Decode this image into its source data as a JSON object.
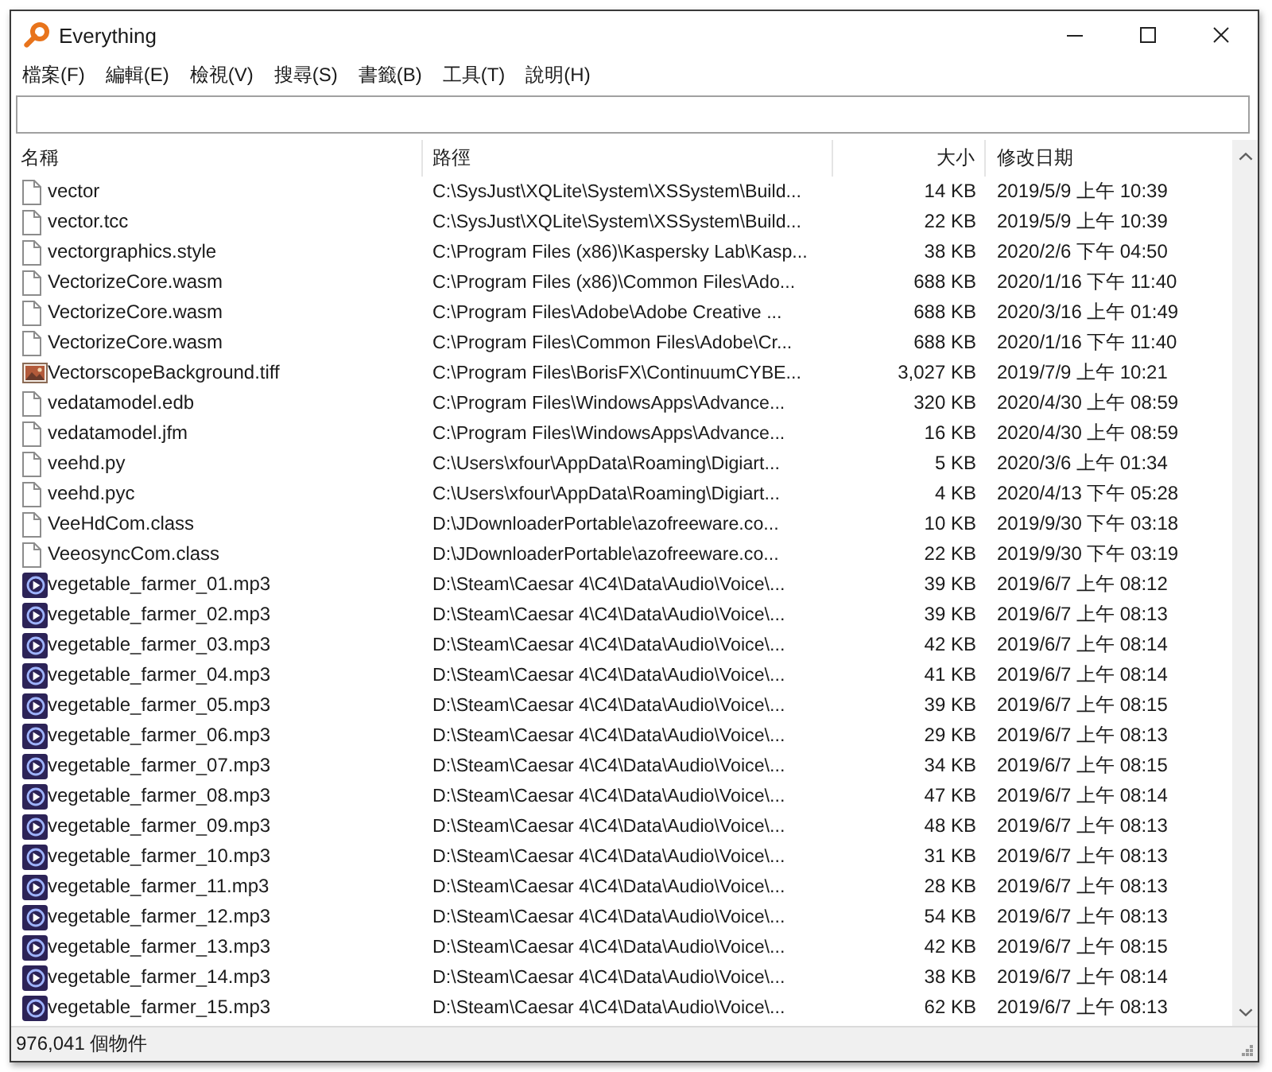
{
  "window": {
    "title": "Everything"
  },
  "menu": [
    "檔案(F)",
    "編輯(E)",
    "檢視(V)",
    "搜尋(S)",
    "書籤(B)",
    "工具(T)",
    "說明(H)"
  ],
  "table": {
    "columns": [
      "名稱",
      "路徑",
      "大小",
      "修改日期"
    ],
    "rows": [
      {
        "kind": "file",
        "name": "vector",
        "path": "C:\\SysJust\\XQLite\\System\\XSSystem\\Build...",
        "size": "14 KB",
        "modified": "2019/5/9 上午 10:39"
      },
      {
        "kind": "file",
        "name": "vector.tcc",
        "path": "C:\\SysJust\\XQLite\\System\\XSSystem\\Build...",
        "size": "22 KB",
        "modified": "2019/5/9 上午 10:39"
      },
      {
        "kind": "file",
        "name": "vectorgraphics.style",
        "path": "C:\\Program Files (x86)\\Kaspersky Lab\\Kasp...",
        "size": "38 KB",
        "modified": "2020/2/6 下午 04:50"
      },
      {
        "kind": "file",
        "name": "VectorizeCore.wasm",
        "path": "C:\\Program Files (x86)\\Common Files\\Ado...",
        "size": "688 KB",
        "modified": "2020/1/16 下午 11:40"
      },
      {
        "kind": "file",
        "name": "VectorizeCore.wasm",
        "path": "C:\\Program Files\\Adobe\\Adobe Creative ...",
        "size": "688 KB",
        "modified": "2020/3/16 上午 01:49"
      },
      {
        "kind": "file",
        "name": "VectorizeCore.wasm",
        "path": "C:\\Program Files\\Common Files\\Adobe\\Cr...",
        "size": "688 KB",
        "modified": "2020/1/16 下午 11:40"
      },
      {
        "kind": "image",
        "name": "VectorscopeBackground.tiff",
        "path": "C:\\Program Files\\BorisFX\\ContinuumCYBE...",
        "size": "3,027 KB",
        "modified": "2019/7/9 上午 10:21"
      },
      {
        "kind": "file",
        "name": "vedatamodel.edb",
        "path": "C:\\Program Files\\WindowsApps\\Advance...",
        "size": "320 KB",
        "modified": "2020/4/30 上午 08:59"
      },
      {
        "kind": "file",
        "name": "vedatamodel.jfm",
        "path": "C:\\Program Files\\WindowsApps\\Advance...",
        "size": "16 KB",
        "modified": "2020/4/30 上午 08:59"
      },
      {
        "kind": "file",
        "name": "veehd.py",
        "path": "C:\\Users\\xfour\\AppData\\Roaming\\Digiart...",
        "size": "5 KB",
        "modified": "2020/3/6 上午 01:34"
      },
      {
        "kind": "file",
        "name": "veehd.pyc",
        "path": "C:\\Users\\xfour\\AppData\\Roaming\\Digiart...",
        "size": "4 KB",
        "modified": "2020/4/13 下午 05:28"
      },
      {
        "kind": "file",
        "name": "VeeHdCom.class",
        "path": "D:\\JDownloaderPortable\\azofreeware.co...",
        "size": "10 KB",
        "modified": "2019/9/30 下午 03:18"
      },
      {
        "kind": "file",
        "name": "VeeosyncCom.class",
        "path": "D:\\JDownloaderPortable\\azofreeware.co...",
        "size": "22 KB",
        "modified": "2019/9/30 下午 03:19"
      },
      {
        "kind": "audio",
        "name": "vegetable_farmer_01.mp3",
        "path": "D:\\Steam\\Caesar 4\\C4\\Data\\Audio\\Voice\\...",
        "size": "39 KB",
        "modified": "2019/6/7 上午 08:12"
      },
      {
        "kind": "audio",
        "name": "vegetable_farmer_02.mp3",
        "path": "D:\\Steam\\Caesar 4\\C4\\Data\\Audio\\Voice\\...",
        "size": "39 KB",
        "modified": "2019/6/7 上午 08:13"
      },
      {
        "kind": "audio",
        "name": "vegetable_farmer_03.mp3",
        "path": "D:\\Steam\\Caesar 4\\C4\\Data\\Audio\\Voice\\...",
        "size": "42 KB",
        "modified": "2019/6/7 上午 08:14"
      },
      {
        "kind": "audio",
        "name": "vegetable_farmer_04.mp3",
        "path": "D:\\Steam\\Caesar 4\\C4\\Data\\Audio\\Voice\\...",
        "size": "41 KB",
        "modified": "2019/6/7 上午 08:14"
      },
      {
        "kind": "audio",
        "name": "vegetable_farmer_05.mp3",
        "path": "D:\\Steam\\Caesar 4\\C4\\Data\\Audio\\Voice\\...",
        "size": "39 KB",
        "modified": "2019/6/7 上午 08:15"
      },
      {
        "kind": "audio",
        "name": "vegetable_farmer_06.mp3",
        "path": "D:\\Steam\\Caesar 4\\C4\\Data\\Audio\\Voice\\...",
        "size": "29 KB",
        "modified": "2019/6/7 上午 08:13"
      },
      {
        "kind": "audio",
        "name": "vegetable_farmer_07.mp3",
        "path": "D:\\Steam\\Caesar 4\\C4\\Data\\Audio\\Voice\\...",
        "size": "34 KB",
        "modified": "2019/6/7 上午 08:15"
      },
      {
        "kind": "audio",
        "name": "vegetable_farmer_08.mp3",
        "path": "D:\\Steam\\Caesar 4\\C4\\Data\\Audio\\Voice\\...",
        "size": "47 KB",
        "modified": "2019/6/7 上午 08:14"
      },
      {
        "kind": "audio",
        "name": "vegetable_farmer_09.mp3",
        "path": "D:\\Steam\\Caesar 4\\C4\\Data\\Audio\\Voice\\...",
        "size": "48 KB",
        "modified": "2019/6/7 上午 08:13"
      },
      {
        "kind": "audio",
        "name": "vegetable_farmer_10.mp3",
        "path": "D:\\Steam\\Caesar 4\\C4\\Data\\Audio\\Voice\\...",
        "size": "31 KB",
        "modified": "2019/6/7 上午 08:13"
      },
      {
        "kind": "audio",
        "name": "vegetable_farmer_11.mp3",
        "path": "D:\\Steam\\Caesar 4\\C4\\Data\\Audio\\Voice\\...",
        "size": "28 KB",
        "modified": "2019/6/7 上午 08:13"
      },
      {
        "kind": "audio",
        "name": "vegetable_farmer_12.mp3",
        "path": "D:\\Steam\\Caesar 4\\C4\\Data\\Audio\\Voice\\...",
        "size": "54 KB",
        "modified": "2019/6/7 上午 08:13"
      },
      {
        "kind": "audio",
        "name": "vegetable_farmer_13.mp3",
        "path": "D:\\Steam\\Caesar 4\\C4\\Data\\Audio\\Voice\\...",
        "size": "42 KB",
        "modified": "2019/6/7 上午 08:15"
      },
      {
        "kind": "audio",
        "name": "vegetable_farmer_14.mp3",
        "path": "D:\\Steam\\Caesar 4\\C4\\Data\\Audio\\Voice\\...",
        "size": "38 KB",
        "modified": "2019/6/7 上午 08:14"
      },
      {
        "kind": "audio",
        "name": "vegetable_farmer_15.mp3",
        "path": "D:\\Steam\\Caesar 4\\C4\\Data\\Audio\\Voice\\...",
        "size": "62 KB",
        "modified": "2019/6/7 上午 08:13"
      }
    ]
  },
  "status_bar": {
    "text": "976,041 個物件"
  }
}
